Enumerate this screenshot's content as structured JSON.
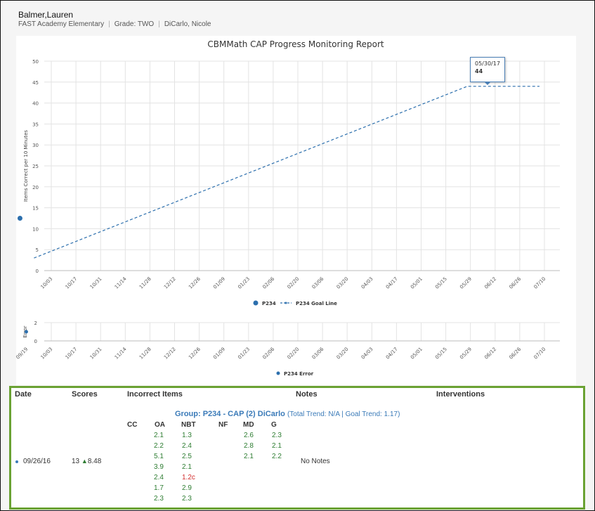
{
  "student": {
    "name": "Balmer,Lauren",
    "school": "FAST Academy Elementary",
    "grade": "Grade: TWO",
    "teacher": "DiCarlo, Nicole"
  },
  "chart_data": [
    {
      "type": "line",
      "title": "CBMMath CAP Progress Monitoring Report",
      "ylabel": "Items Correct per 10 Minutes",
      "xlabel": "",
      "ylim": [
        0,
        50
      ],
      "yticks": [
        "0",
        "5",
        "10",
        "15",
        "20",
        "25",
        "30",
        "35",
        "40",
        "45",
        "50"
      ],
      "xticks": [
        "10/03",
        "10/17",
        "10/31",
        "11/14",
        "11/28",
        "12/12",
        "12/26",
        "01/09",
        "01/23",
        "02/06",
        "02/20",
        "03/06",
        "03/20",
        "04/03",
        "04/17",
        "05/01",
        "05/15",
        "05/29",
        "06/12",
        "06/26",
        "07/10"
      ],
      "grid": true,
      "legend_position": "bottom",
      "series": [
        {
          "name": "P234",
          "type": "scatter",
          "color": "#2c6fad",
          "points": [
            {
              "x": "09/26/16",
              "y": 12.5
            }
          ]
        },
        {
          "name": "P234 Goal Line",
          "type": "dashed-line",
          "color": "#2c6fad",
          "points": [
            {
              "x": "09/26/16",
              "y": 3
            },
            {
              "x": "05/30/17",
              "y": 44
            },
            {
              "x": "07/10/17",
              "y": 44
            }
          ]
        }
      ],
      "tooltip": {
        "date": "05/30/17",
        "value": "44"
      }
    },
    {
      "type": "scatter",
      "ylabel": "Error",
      "ylim": [
        0,
        2
      ],
      "yticks": [
        "0",
        "2"
      ],
      "xticks": [
        "09/19",
        "10/03",
        "10/17",
        "10/31",
        "11/14",
        "11/28",
        "12/12",
        "12/26",
        "01/09",
        "01/23",
        "02/06",
        "02/20",
        "03/06",
        "03/20",
        "04/03",
        "04/17",
        "05/01",
        "05/15",
        "05/29",
        "06/12",
        "06/26",
        "07/10"
      ],
      "grid": true,
      "legend_position": "bottom",
      "series": [
        {
          "name": "P234 Error",
          "color": "#2c6fad",
          "points": [
            {
              "x": "09/26/16",
              "y": 1
            }
          ]
        }
      ]
    }
  ],
  "table": {
    "headers": {
      "date": "Date",
      "scores": "Scores",
      "incorrect": "Incorrect Items",
      "notes": "Notes",
      "interventions": "Interventions"
    },
    "group": {
      "name": "Group: P234 - CAP (2) DiCarlo",
      "trend": "(Total Trend: N/A | Goal Trend: 1.17)"
    },
    "domains": [
      "CC",
      "OA",
      "NBT",
      "NF",
      "MD",
      "G"
    ],
    "items": {
      "OA": [
        "2.1",
        "2.2",
        "5.1",
        "3.9",
        "2.4",
        "1.7",
        "2.3"
      ],
      "NBT": [
        "1.3",
        "2.4",
        "2.5",
        "2.1",
        "1.2c",
        "2.9",
        "2.3"
      ],
      "MD": [
        "2.6",
        "2.8",
        "2.1"
      ],
      "G": [
        "2.3",
        "2.1",
        "2.2"
      ]
    },
    "row": {
      "date": "09/26/16",
      "score": "13",
      "trend": "8.48",
      "notes": "No Notes"
    },
    "colors": {
      "correct": "#2e7d32",
      "error": "#d32f2f",
      "group": "#3a7ab8",
      "border": "#6aa233"
    }
  }
}
